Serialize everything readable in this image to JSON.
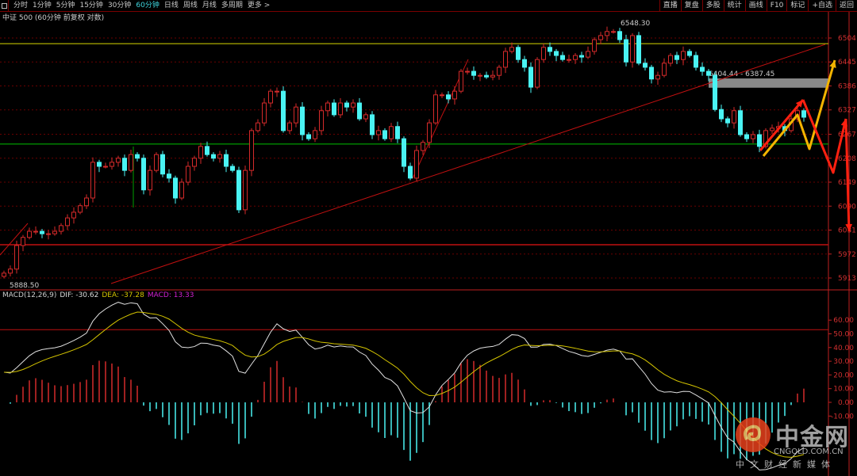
{
  "toolbar": {
    "tabs": [
      {
        "label": "分时"
      },
      {
        "label": "1分钟"
      },
      {
        "label": "5分钟"
      },
      {
        "label": "15分钟"
      },
      {
        "label": "30分钟"
      },
      {
        "label": "60分钟",
        "active": true
      },
      {
        "label": "日线"
      },
      {
        "label": "周线"
      },
      {
        "label": "月线"
      },
      {
        "label": "多周期"
      },
      {
        "label": "更多 >"
      }
    ],
    "right_buttons": [
      {
        "label": "直播"
      },
      {
        "label": "复盘"
      },
      {
        "label": "多股"
      },
      {
        "label": "统计"
      },
      {
        "label": "画线"
      },
      {
        "label": "F10"
      },
      {
        "label": "标记"
      },
      {
        "label": "+自选"
      },
      {
        "label": "返回"
      }
    ]
  },
  "subtitle": "中证 500 (60分钟 前复权 对数)",
  "macd_legend": {
    "name": "MACD(12,26,9)",
    "dif": "DIF: -30.62",
    "dea": "DEA: -37.28",
    "macd": "MACD: 13.33"
  },
  "colors": {
    "up": "#d42a2a",
    "down": "#4af3f3",
    "axis": "#c02020",
    "dif": "#e0e0e0",
    "dea": "#d4c400",
    "macd_label": "#d020d0",
    "hline_yellow": "#d8d800",
    "hline_green": "#00c000",
    "band": "#888888",
    "arrow_red": "#ff2010",
    "arrow_yellow": "#f4b400"
  },
  "chart_data": {
    "type": "candlestick",
    "interval": "60分钟",
    "price_axis": {
      "ticks": [
        6504,
        6445,
        6386,
        6327,
        6267,
        6208,
        6149,
        6090,
        6031,
        5972,
        5913
      ],
      "range": [
        5880,
        6590
      ],
      "scale": "log"
    },
    "macd_axis": {
      "ticks": [
        "60.00",
        "50.00",
        "40.00",
        "30.00",
        "20.00",
        "10.00",
        "0.00",
        "-10.00"
      ],
      "range": [
        -55,
        80
      ]
    },
    "close": [
      5925,
      5935,
      5993,
      6013,
      6028,
      6028,
      6022,
      6022,
      6028,
      6042,
      6061,
      6075,
      6091,
      6110,
      6198,
      6188,
      6188,
      6198,
      6208,
      6178,
      6217,
      6208,
      6130,
      6178,
      6217,
      6169,
      6159,
      6110,
      6149,
      6188,
      6208,
      6237,
      6217,
      6208,
      6217,
      6188,
      6178,
      6081,
      6178,
      6276,
      6295,
      6344,
      6373,
      6373,
      6276,
      6295,
      6334,
      6266,
      6256,
      6276,
      6325,
      6344,
      6315,
      6344,
      6334,
      6344,
      6305,
      6315,
      6266,
      6276,
      6256,
      6286,
      6256,
      6188,
      6159,
      6227,
      6247,
      6295,
      6364,
      6364,
      6354,
      6373,
      6422,
      6422,
      6412,
      6412,
      6408,
      6412,
      6432,
      6471,
      6481,
      6451,
      6432,
      6383,
      6451,
      6481,
      6471,
      6461,
      6451,
      6451,
      6461,
      6457,
      6471,
      6500,
      6510,
      6520,
      6520,
      6500,
      6445,
      6510,
      6442,
      6432,
      6403,
      6412,
      6442,
      6461,
      6451,
      6471,
      6461,
      6432,
      6422,
      6412,
      6328,
      6305,
      6295,
      6325,
      6266,
      6256,
      6266,
      6237,
      6276,
      6282,
      6286,
      6276,
      6305,
      6325,
      6309
    ],
    "annotations": {
      "high_label": "6548.30",
      "low_label": "5888.50",
      "band_label": "6404.44 - 6387.45",
      "band": [
        6387.45,
        6404.44
      ],
      "hline_yellow": 6490,
      "hline_green": 6243,
      "hline_red": 5995,
      "macd_hline": 53
    }
  },
  "watermark": {
    "name": "中金网",
    "url": "CNGOLD.COM.CN",
    "tagline": "中文财经新媒体"
  }
}
